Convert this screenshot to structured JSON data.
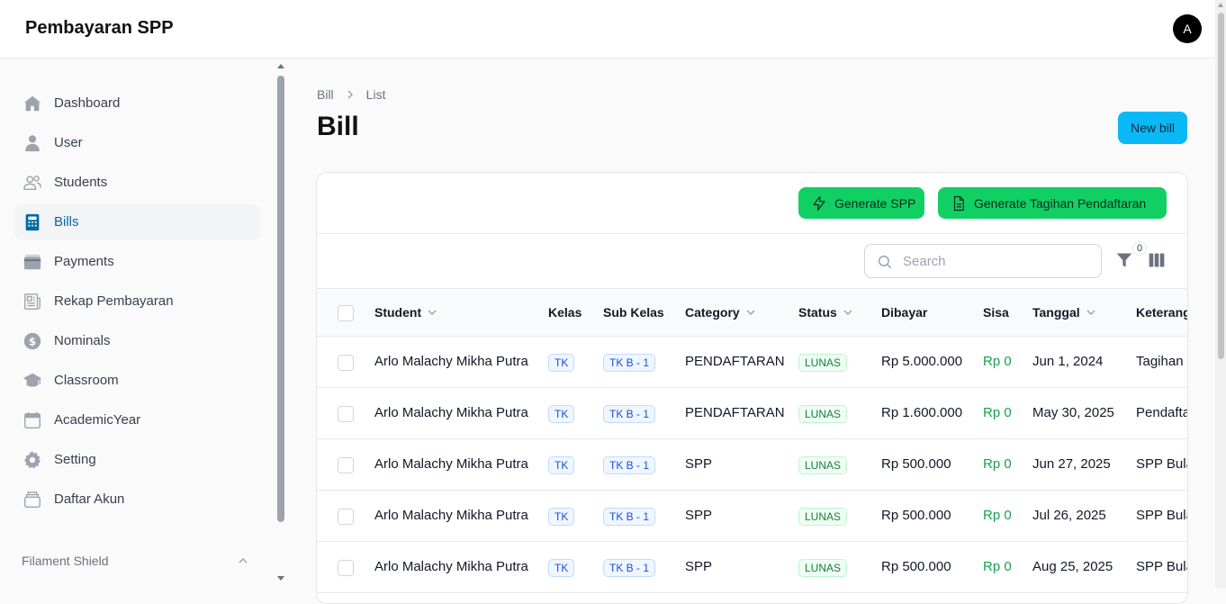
{
  "app": {
    "title": "Pembayaran SPP",
    "avatar_initial": "A"
  },
  "sidebar": {
    "items": [
      {
        "label": "Dashboard",
        "icon": "home-icon",
        "active": false
      },
      {
        "label": "User",
        "icon": "user-icon",
        "active": false
      },
      {
        "label": "Students",
        "icon": "users-icon",
        "active": false
      },
      {
        "label": "Bills",
        "icon": "calculator-icon",
        "active": true
      },
      {
        "label": "Payments",
        "icon": "wallet-icon",
        "active": false
      },
      {
        "label": "Rekap Pembayaran",
        "icon": "newspaper-icon",
        "active": false
      },
      {
        "label": "Nominals",
        "icon": "currency-icon",
        "active": false
      },
      {
        "label": "Classroom",
        "icon": "academic-cap-icon",
        "active": false
      },
      {
        "label": "AcademicYear",
        "icon": "calendar-icon",
        "active": false
      },
      {
        "label": "Setting",
        "icon": "gear-icon",
        "active": false
      },
      {
        "label": "Daftar Akun",
        "icon": "archive-icon",
        "active": false
      }
    ],
    "group_label": "Filament Shield"
  },
  "breadcrumb": {
    "parent": "Bill",
    "current": "List"
  },
  "page": {
    "title": "Bill",
    "new_button": "New bill"
  },
  "actions": {
    "generate_spp": "Generate SPP",
    "generate_tagihan": "Generate Tagihan Pendaftaran"
  },
  "toolbar": {
    "search_placeholder": "Search",
    "filter_count": "0"
  },
  "table": {
    "columns": [
      "Student",
      "Kelas",
      "Sub Kelas",
      "Category",
      "Status",
      "Dibayar",
      "Sisa",
      "Tanggal",
      "Keterang"
    ],
    "rows": [
      {
        "student": "Arlo Malachy Mikha Putra",
        "kelas": "TK",
        "sub_kelas": "TK B - 1",
        "category": "PENDAFTARAN",
        "status": "LUNAS",
        "dibayar": "Rp 5.000.000",
        "sisa": "Rp 0",
        "tanggal": "Jun 1, 2024",
        "keterangan": "Tagihan"
      },
      {
        "student": "Arlo Malachy Mikha Putra",
        "kelas": "TK",
        "sub_kelas": "TK B - 1",
        "category": "PENDAFTARAN",
        "status": "LUNAS",
        "dibayar": "Rp 1.600.000",
        "sisa": "Rp 0",
        "tanggal": "May 30, 2025",
        "keterangan": "Pendafta"
      },
      {
        "student": "Arlo Malachy Mikha Putra",
        "kelas": "TK",
        "sub_kelas": "TK B - 1",
        "category": "SPP",
        "status": "LUNAS",
        "dibayar": "Rp 500.000",
        "sisa": "Rp 0",
        "tanggal": "Jun 27, 2025",
        "keterangan": "SPP Bula"
      },
      {
        "student": "Arlo Malachy Mikha Putra",
        "kelas": "TK",
        "sub_kelas": "TK B - 1",
        "category": "SPP",
        "status": "LUNAS",
        "dibayar": "Rp 500.000",
        "sisa": "Rp 0",
        "tanggal": "Jul 26, 2025",
        "keterangan": "SPP Bula"
      },
      {
        "student": "Arlo Malachy Mikha Putra",
        "kelas": "TK",
        "sub_kelas": "TK B - 1",
        "category": "SPP",
        "status": "LUNAS",
        "dibayar": "Rp 500.000",
        "sisa": "Rp 0",
        "tanggal": "Aug 25, 2025",
        "keterangan": "SPP Bula"
      }
    ]
  }
}
